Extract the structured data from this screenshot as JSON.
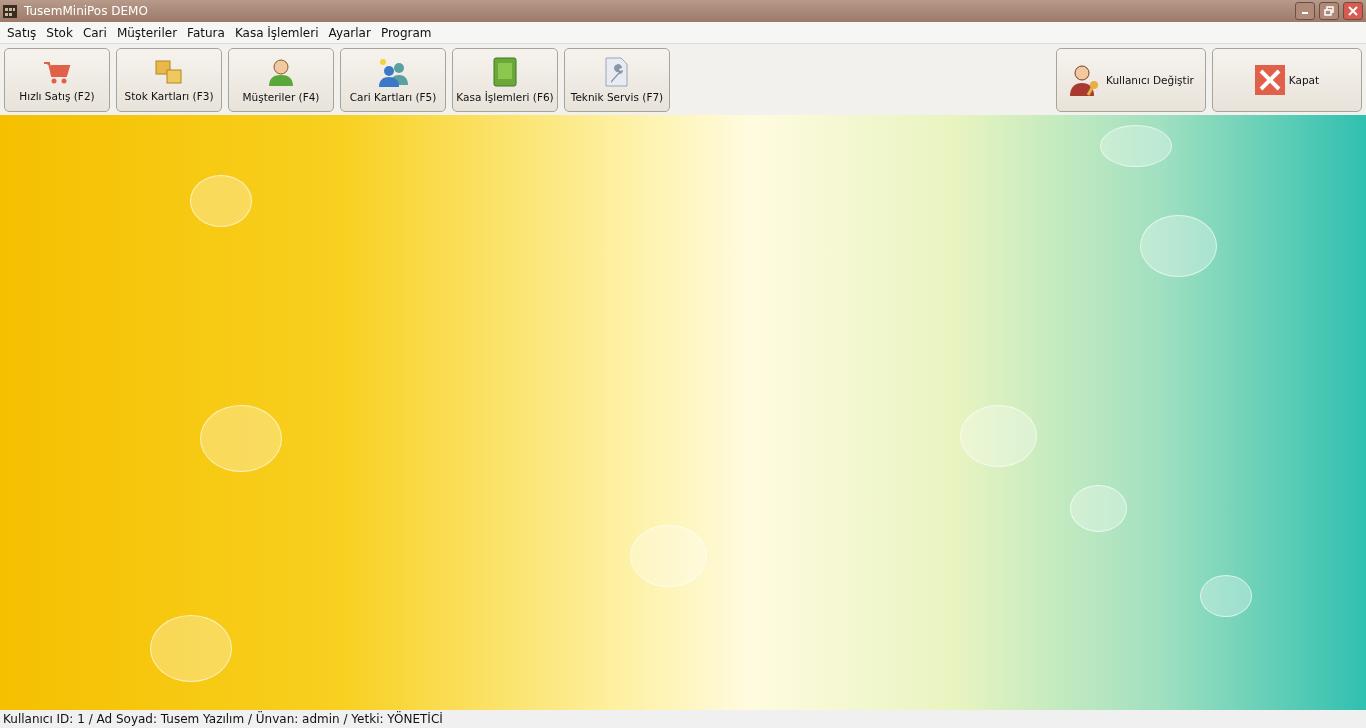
{
  "window": {
    "title": "TusemMiniPos DEMO"
  },
  "menu": [
    "Satış",
    "Stok",
    "Cari",
    "Müşteriler",
    "Fatura",
    "Kasa İşlemleri",
    "Ayarlar",
    "Program"
  ],
  "toolbar_left": [
    {
      "label": "Hızlı Satış (F2)",
      "kind": "cart"
    },
    {
      "label": "Stok Kartları (F3)",
      "kind": "boxes"
    },
    {
      "label": "Müşteriler (F4)",
      "kind": "person"
    },
    {
      "label": "Cari Kartları (F5)",
      "kind": "people"
    },
    {
      "label": "Kasa İşlemleri (F6)",
      "kind": "book"
    },
    {
      "label": "Teknik Servis (F7)",
      "kind": "wrench"
    }
  ],
  "toolbar_right": [
    {
      "label": "Kullanıcı Değiştir",
      "kind": "user-key"
    },
    {
      "label": "Kapat",
      "kind": "close"
    }
  ],
  "status_bar": "Kullanıcı ID: 1 / Ad Soyad: Tusem Yazılım / Ünvan: admin / Yetki: YÖNETİCİ"
}
